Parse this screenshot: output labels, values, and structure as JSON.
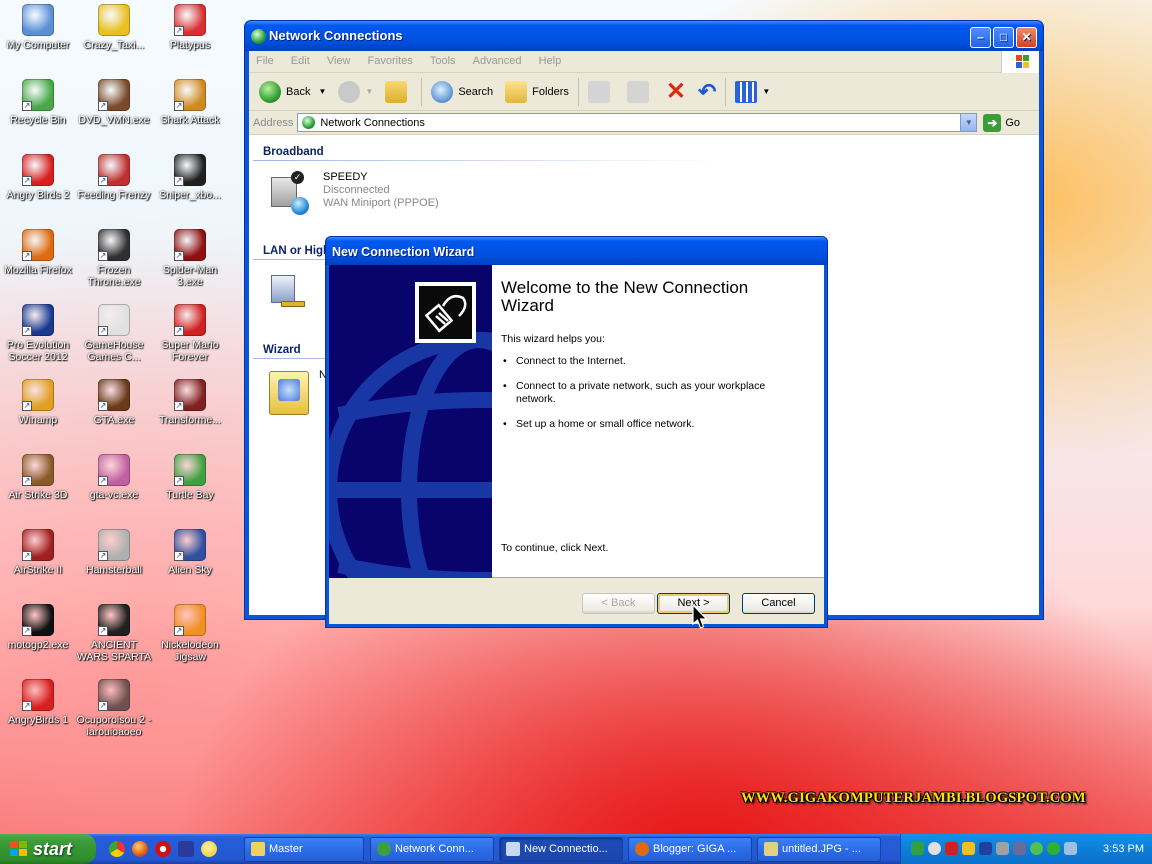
{
  "desktop": {
    "icons": [
      {
        "label": "My Computer",
        "color": "#5c8fd6"
      },
      {
        "label": "Crazy_Taxi...",
        "color": "#e8c020"
      },
      {
        "label": "Platypus",
        "color": "#d83030"
      },
      {
        "label": "Recycle Bin",
        "color": "#4aa84a"
      },
      {
        "label": "DVD_VMN.exe",
        "color": "#7a4a2a"
      },
      {
        "label": "Shark Attack",
        "color": "#d08a20"
      },
      {
        "label": "Angry Birds 2",
        "color": "#d82020"
      },
      {
        "label": "Feeding Frenzy",
        "color": "#c03030"
      },
      {
        "label": "Sniper_xbo...",
        "color": "#202020"
      },
      {
        "label": "Mozilla Firefox",
        "color": "#e06a10"
      },
      {
        "label": "Frozen Throne.exe",
        "color": "#303030"
      },
      {
        "label": "Spider-Man 3.exe",
        "color": "#901010"
      },
      {
        "label": "Pro Evolution Soccer 2012",
        "color": "#1a3a90"
      },
      {
        "label": "GameHouse Games C...",
        "color": "#e0e0e0"
      },
      {
        "label": "Super Mario Forever",
        "color": "#d02020"
      },
      {
        "label": "Winamp",
        "color": "#e0a020"
      },
      {
        "label": "GTA.exe",
        "color": "#6a3a1a"
      },
      {
        "label": "Transforme...",
        "color": "#802020"
      },
      {
        "label": "Air Strike 3D",
        "color": "#8a5a2a"
      },
      {
        "label": "gta-vc.exe",
        "color": "#c060a0"
      },
      {
        "label": "Turtle Bay",
        "color": "#40a040"
      },
      {
        "label": "AirStrike II",
        "color": "#a02020"
      },
      {
        "label": "Hamsterball",
        "color": "#b0b0b0"
      },
      {
        "label": "Alien Sky",
        "color": "#3050a0"
      },
      {
        "label": "motogp2.exe",
        "color": "#101010"
      },
      {
        "label": "ANCIENT WARS SPARTA",
        "color": "#202020"
      },
      {
        "label": "Nickelodeon Jigsaw",
        "color": "#f09020"
      },
      {
        "label": "AngryBirds 1",
        "color": "#d82020"
      },
      {
        "label": "Ocuporoisou 2 - iarouioaoeo",
        "color": "#705050"
      }
    ]
  },
  "explorer": {
    "title": "Network Connections",
    "menu": [
      "File",
      "Edit",
      "View",
      "Favorites",
      "Tools",
      "Advanced",
      "Help"
    ],
    "toolbar": {
      "back": "Back",
      "search": "Search",
      "folders": "Folders"
    },
    "address_label": "Address",
    "address_value": "Network Connections",
    "go_label": "Go",
    "groups": {
      "broadband": "Broadband",
      "lan": "LAN or High",
      "wizard": "Wizard"
    },
    "connection": {
      "name": "SPEEDY",
      "status": "Disconnected",
      "device": "WAN Miniport (PPPOE)"
    },
    "lan_item_partial": "Lo",
    "lan_item_partial_2": "C",
    "lan_item_partial_3": "N",
    "wizard_item_partial": "N"
  },
  "wizard": {
    "title": "New Connection Wizard",
    "heading": "Welcome to the New Connection Wizard",
    "intro": "This wizard helps you:",
    "bullets": [
      "Connect to the Internet.",
      "Connect to a private network, such as your workplace network.",
      "Set up a home or small office network."
    ],
    "continue_text": "To continue, click Next.",
    "buttons": {
      "back": "< Back",
      "next": "Next >",
      "cancel": "Cancel"
    }
  },
  "taskbar": {
    "start_label": "start",
    "tasks": [
      {
        "label": "Master",
        "active": false
      },
      {
        "label": "Network Conn...",
        "active": false
      },
      {
        "label": "New Connectio...",
        "active": true
      },
      {
        "label": "Blogger: GIGA ...",
        "active": false
      },
      {
        "label": "untitled.JPG - ...",
        "active": false
      }
    ],
    "clock": "3:53 PM"
  },
  "watermark": "WWW.GIGAKOMPUTERJAMBI.BLOGSPOT.COM",
  "colors": {
    "xp_blue": "#0058ee",
    "start_green": "#3c9d3a",
    "wizard_banner": "#08046c",
    "watermark_yellow": "#ffe000"
  }
}
